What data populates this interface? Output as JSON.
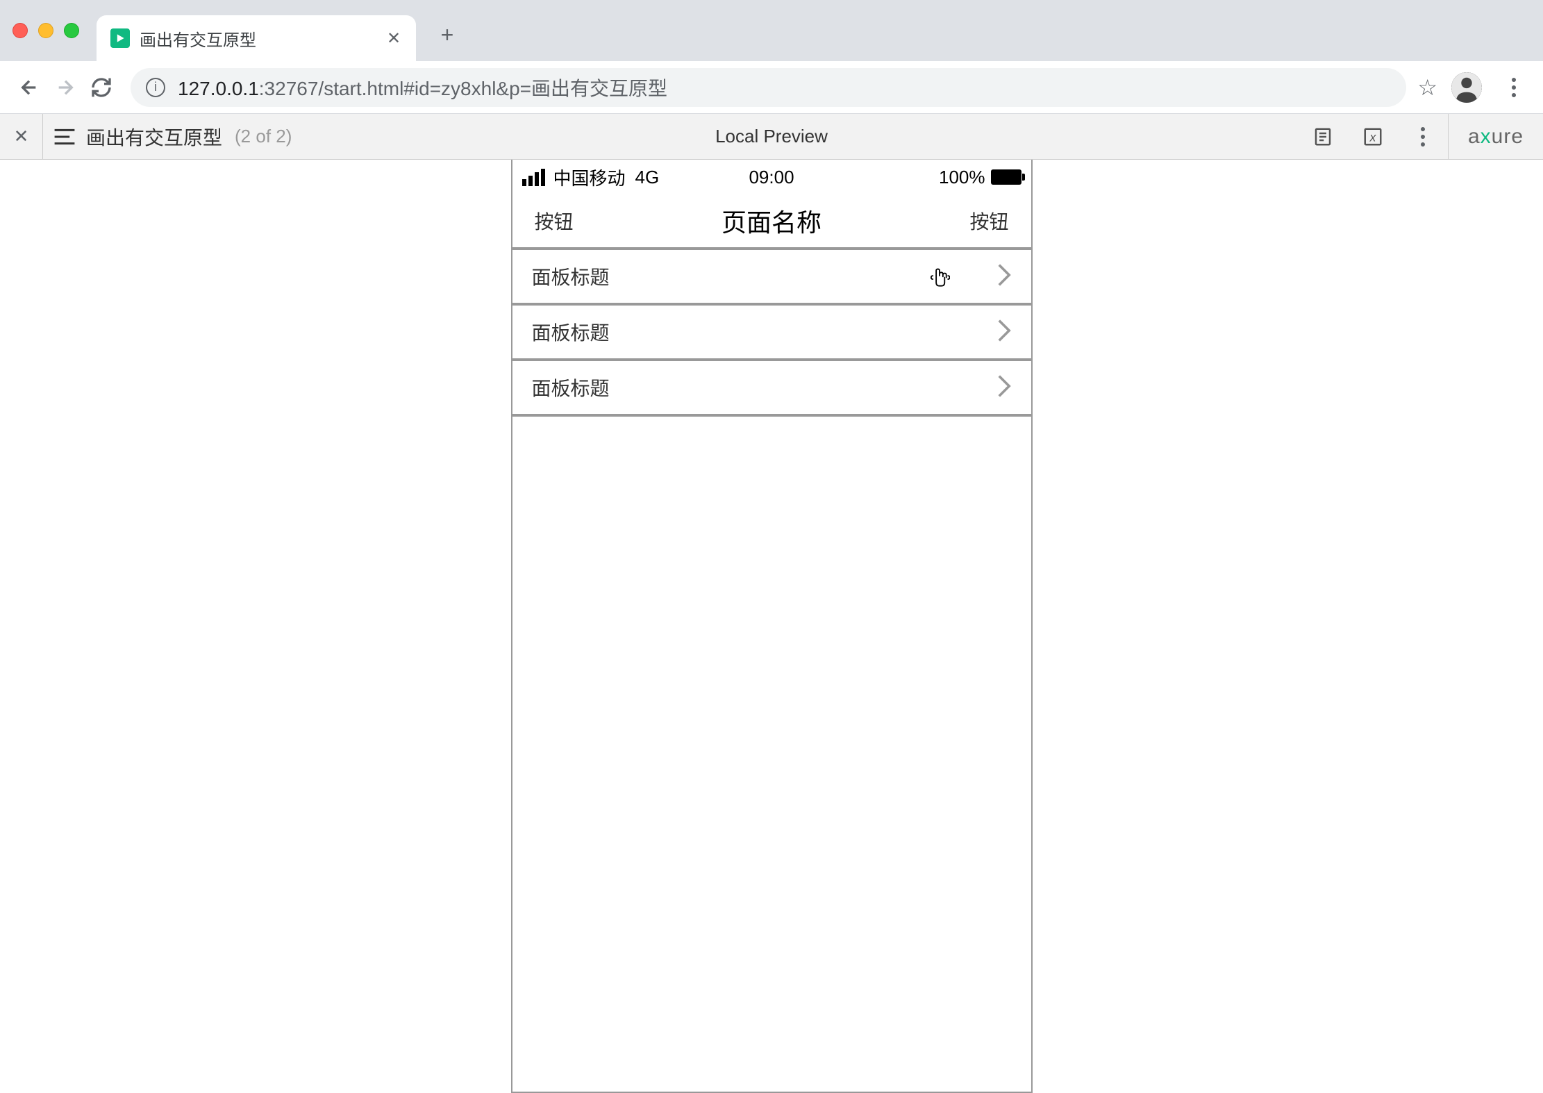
{
  "browser": {
    "tab_title": "画出有交互原型",
    "url_host": "127.0.0.1",
    "url_path": ":32767/start.html#id=zy8xhl&p=画出有交互原型"
  },
  "axure_bar": {
    "page_name": "画出有交互原型",
    "page_count": "(2 of 2)",
    "center_label": "Local Preview",
    "logo_prefix": "a",
    "logo_x": "x",
    "logo_suffix": "ure"
  },
  "mobile": {
    "status": {
      "carrier": "中国移动",
      "network": "4G",
      "time": "09:00",
      "battery": "100%"
    },
    "nav": {
      "left": "按钮",
      "title": "页面名称",
      "right": "按钮"
    },
    "items": [
      {
        "title": "面板标题"
      },
      {
        "title": "面板标题"
      },
      {
        "title": "面板标题"
      }
    ]
  }
}
